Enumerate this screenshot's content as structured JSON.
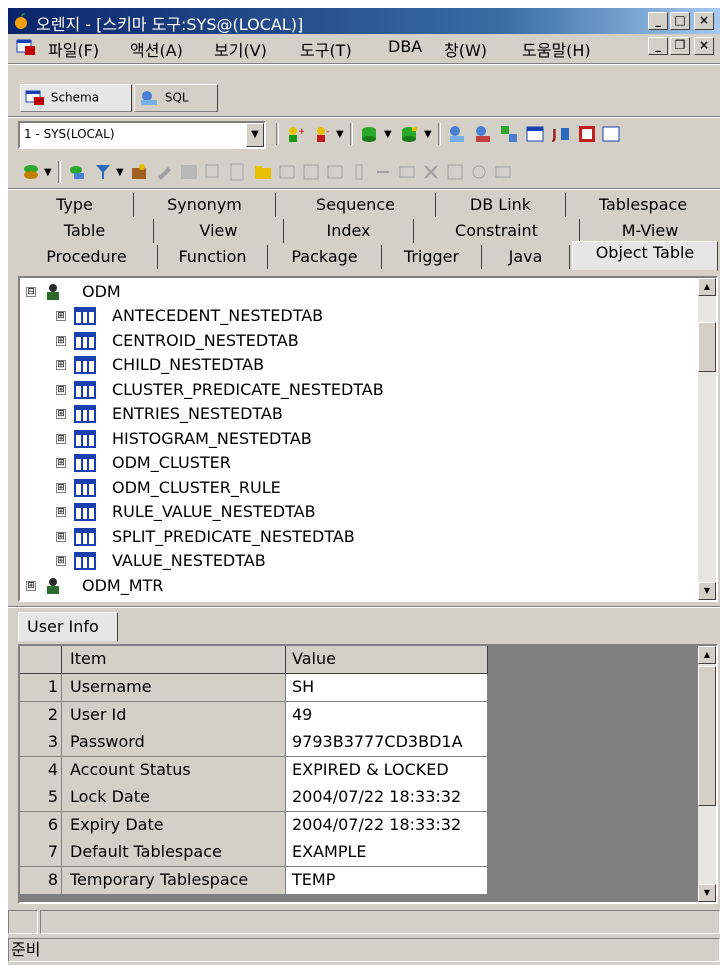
{
  "window": {
    "title": "오렌지 - [스키마 도구:SYS@(LOCAL)]",
    "caption_buttons": [
      "_",
      "□",
      "×"
    ],
    "mdi_buttons": [
      "_",
      "❐",
      "×"
    ]
  },
  "menu": {
    "items": [
      "파일(F)",
      "액션(A)",
      "보기(V)",
      "도구(T)",
      "DBA",
      "창(W)",
      "도움말(H)"
    ]
  },
  "top_tabs": [
    "Schema",
    "SQL"
  ],
  "connection": {
    "selected": "1 - SYS(LOCAL)"
  },
  "object_tabs": {
    "rows": [
      [
        "Type",
        "Synonym",
        "Sequence",
        "DB Link",
        "Tablespace"
      ],
      [
        "Table",
        "View",
        "Index",
        "Constraint",
        "M-View"
      ],
      [
        "Procedure",
        "Function",
        "Package",
        "Trigger",
        "Java",
        "Object Table"
      ]
    ],
    "active": "Object Table"
  },
  "tree": {
    "schema": "ODM",
    "children": [
      "ANTECEDENT_NESTEDTAB",
      "CENTROID_NESTEDTAB",
      "CHILD_NESTEDTAB",
      "CLUSTER_PREDICATE_NESTEDTAB",
      "ENTRIES_NESTEDTAB",
      "HISTOGRAM_NESTEDTAB",
      "ODM_CLUSTER",
      "ODM_CLUSTER_RULE",
      "RULE_VALUE_NESTEDTAB",
      "SPLIT_PREDICATE_NESTEDTAB",
      "VALUE_NESTEDTAB"
    ],
    "next_schema": "ODM_MTR",
    "expand_symbol": "⊞",
    "collapse_symbol": "⊟"
  },
  "user_info": {
    "tab_label": "User Info",
    "columns": [
      "Item",
      "Value"
    ],
    "rows": [
      {
        "num": "1",
        "item": "Username",
        "value": "SH"
      },
      {
        "num": "2",
        "item": "User Id",
        "value": "49"
      },
      {
        "num": "3",
        "item": "Password",
        "value": "9793B3777CD3BD1A"
      },
      {
        "num": "4",
        "item": "Account Status",
        "value": "EXPIRED & LOCKED"
      },
      {
        "num": "5",
        "item": "Lock Date",
        "value": "2004/07/22 18:33:32"
      },
      {
        "num": "6",
        "item": "Expiry Date",
        "value": "2004/07/22 18:33:32"
      },
      {
        "num": "7",
        "item": "Default Tablespace",
        "value": "EXAMPLE"
      },
      {
        "num": "8",
        "item": "Temporary Tablespace",
        "value": "TEMP"
      }
    ]
  },
  "status": {
    "text": "준비"
  },
  "colors": {
    "titlebar_start": "#0a246a",
    "titlebar_end": "#a6caf0",
    "chrome": "#d4d0c8",
    "table_icon": "#1a3fb0",
    "schema_icon": "#2b6b2b"
  },
  "icons": {
    "app": "orange-icon",
    "schema_tab": "schema-icon",
    "sql_tab": "sql-icon",
    "table": "table-icon",
    "schema_user": "schema-user-icon"
  }
}
